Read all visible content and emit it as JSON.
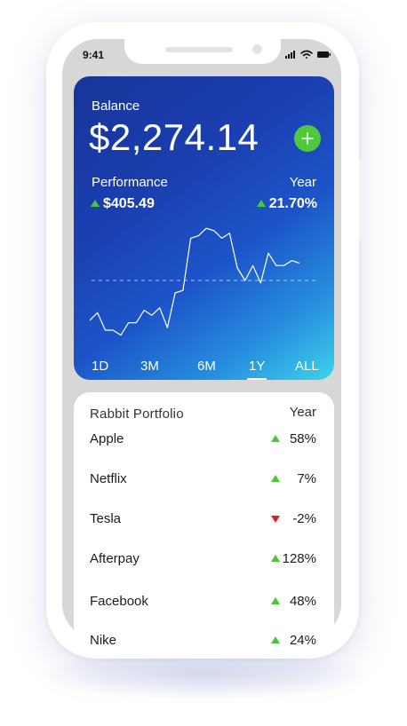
{
  "status_bar": {
    "time": "9:41"
  },
  "balance": {
    "label": "Balance",
    "amount": "$2,274.14",
    "add_symbol": "+"
  },
  "performance": {
    "label": "Performance",
    "period_label": "Year",
    "change_amount": "$405.49",
    "change_percent": "21.70%",
    "direction": "up"
  },
  "chart_data": {
    "type": "line",
    "series_values": [
      64,
      67,
      60,
      60,
      58,
      63,
      63,
      68,
      66,
      69,
      61,
      75,
      76,
      97,
      98,
      101,
      100,
      97,
      99,
      85,
      80,
      86,
      79,
      91,
      86,
      86,
      88,
      87
    ],
    "baseline_value": 80,
    "baseline_style": "dashed"
  },
  "periods": [
    {
      "label": "1D",
      "active": false
    },
    {
      "label": "3M",
      "active": false
    },
    {
      "label": "6M",
      "active": false
    },
    {
      "label": "1Y",
      "active": true
    },
    {
      "label": "ALL",
      "active": false
    }
  ],
  "portfolio": {
    "title": "Rabbit Portfolio",
    "period_label": "Year",
    "items": [
      {
        "name": "Apple",
        "change": "58%",
        "direction": "up"
      },
      {
        "name": "Netflix",
        "change": "7%",
        "direction": "up"
      },
      {
        "name": "Tesla",
        "change": "-2%",
        "direction": "down"
      },
      {
        "name": "Afterpay",
        "change": "128%",
        "direction": "up"
      },
      {
        "name": "Facebook",
        "change": "48%",
        "direction": "up"
      },
      {
        "name": "Nike",
        "change": "24%",
        "direction": "up"
      }
    ]
  },
  "colors": {
    "up": "#47c83a",
    "down": "#e0201d",
    "add_button": "#51c93d",
    "card_gradient_start": "#17359a",
    "card_gradient_end": "#3ed3ea"
  }
}
